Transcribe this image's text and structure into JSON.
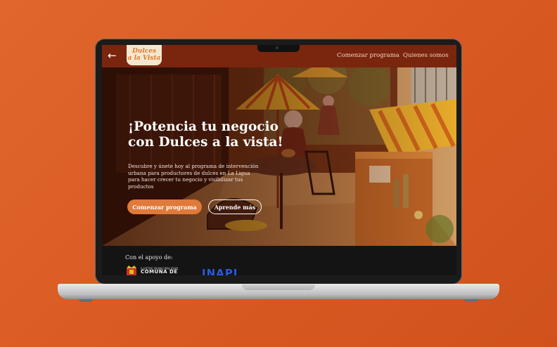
{
  "nav": {
    "back_icon": "arrow-left-icon",
    "logo_line1": "Dulces",
    "logo_line2": "a la Vista",
    "links": [
      "Comenzar programa",
      "Quienes somos"
    ]
  },
  "hero": {
    "title": "¡Potencia tu negocio con Dulces a la vista!",
    "subtitle": "Descubre y únete hoy al programa de intervención urbana para productores de dulces en La Ligua para hacer crecer tu negocio y visibilizar tus productos",
    "primary_button": "Comenzar programa",
    "secondary_button": "Aprende más"
  },
  "support": {
    "label": "Con el apoyo de:",
    "muni_small": "ILUSTRE MUNICIPALIDAD",
    "muni_big": "COMUNA DE",
    "inapi": "INAPI"
  },
  "colors": {
    "background": "#d85a22",
    "navbar": "#7a250d",
    "accent": "#df7a3b",
    "logo_bg": "#f4e7cf"
  }
}
